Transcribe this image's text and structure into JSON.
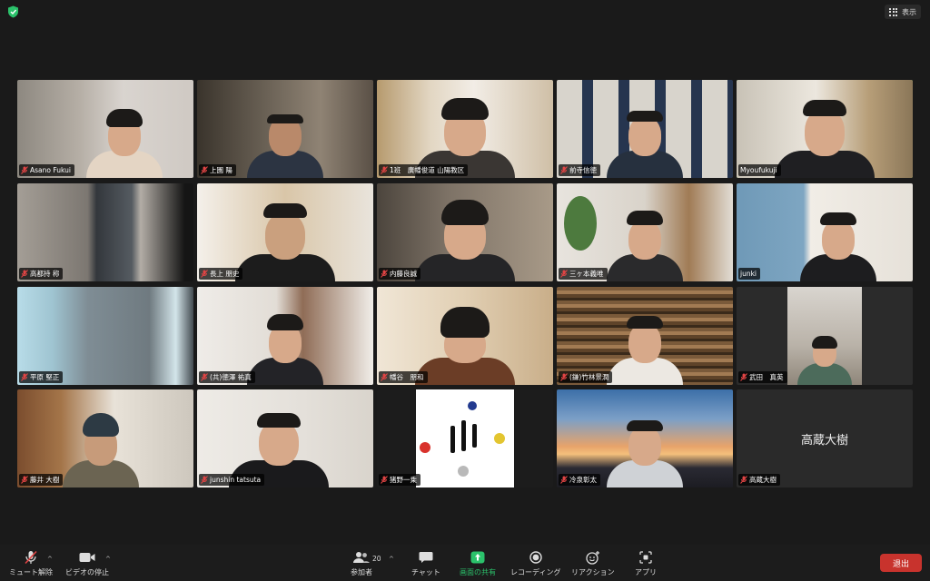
{
  "top": {
    "view_label": "表示"
  },
  "participants": [
    {
      "name": "Asano Fukui",
      "active": false
    },
    {
      "name": "上園 陽",
      "active": false
    },
    {
      "name": "1班　廣幡俊道 山陽教区",
      "active": false
    },
    {
      "name": "前寺信徳",
      "active": false
    },
    {
      "name": "Myoufukuji",
      "active": true
    },
    {
      "name": "高都持 称",
      "active": false
    },
    {
      "name": "長上 朋史",
      "active": false
    },
    {
      "name": "内藤良誠",
      "active": false
    },
    {
      "name": "三ヶ本義唯",
      "active": false
    },
    {
      "name": "junki",
      "active": false
    },
    {
      "name": "平原 堅正",
      "active": false
    },
    {
      "name": "(共)徳澤 祐真",
      "active": false
    },
    {
      "name": "幡谷　朋和",
      "active": false
    },
    {
      "name": "(鎌)竹林景潤",
      "active": false
    },
    {
      "name": "武田　真英",
      "active": false
    },
    {
      "name": "藤井 大樹",
      "active": false
    },
    {
      "name": "junshin tatsuta",
      "active": false
    },
    {
      "name": "猪野一乗",
      "active": false
    },
    {
      "name": "冷泉彰太",
      "active": false
    },
    {
      "name": "高蔵大樹",
      "active": false,
      "display_name_center": "高蔵大樹"
    }
  ],
  "toolbar": {
    "unmute_label": "ミュート解除",
    "stop_video_label": "ビデオの停止",
    "participants_label": "参加者",
    "participants_count": "20",
    "chat_label": "チャット",
    "share_label": "画面の共有",
    "record_label": "レコーディング",
    "reaction_label": "リアクション",
    "apps_label": "アプリ",
    "leave_label": "退出"
  },
  "colors": {
    "active_speaker": "#7be36b",
    "share_green": "#2bc26b",
    "leave_red": "#c8332d",
    "muted_red": "#e04444"
  }
}
